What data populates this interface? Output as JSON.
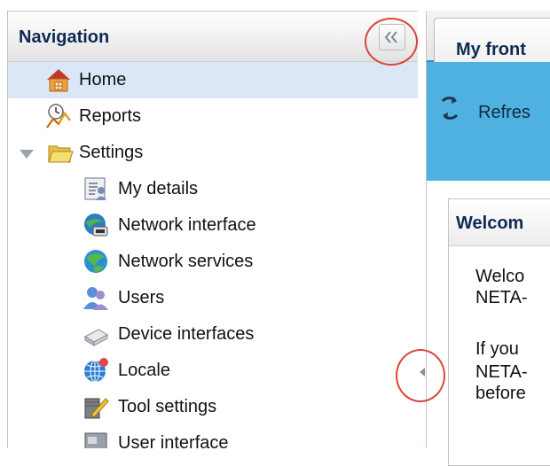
{
  "navigation": {
    "title": "Navigation",
    "collapse_icon": "double-chevron-left-icon",
    "items": [
      {
        "label": "Home",
        "icon": "home-icon",
        "selected": true
      },
      {
        "label": "Reports",
        "icon": "reports-icon"
      },
      {
        "label": "Settings",
        "icon": "folder-open-icon",
        "expanded": true
      },
      {
        "label": "My details",
        "icon": "my-details-icon"
      },
      {
        "label": "Network interface",
        "icon": "network-interface-icon"
      },
      {
        "label": "Network services",
        "icon": "network-services-icon"
      },
      {
        "label": "Users",
        "icon": "users-icon"
      },
      {
        "label": "Device interfaces",
        "icon": "device-interfaces-icon"
      },
      {
        "label": "Locale",
        "icon": "locale-icon"
      },
      {
        "label": "Tool settings",
        "icon": "tool-settings-icon"
      },
      {
        "label": "User interface",
        "icon": "user-interface-icon"
      }
    ]
  },
  "main": {
    "tab_label": "My front",
    "toolbar": {
      "refresh_label": "Refres"
    },
    "panel": {
      "title": "Welcom",
      "lines": [
        "Welco",
        "NETA-",
        "If you",
        "NETA-",
        "before"
      ]
    }
  },
  "colors": {
    "selected_row": "#dbe7f7",
    "toolbar_blue": "#4fb1e0",
    "heading_navy": "#0f2a52",
    "annotation_red": "#d9473c"
  }
}
